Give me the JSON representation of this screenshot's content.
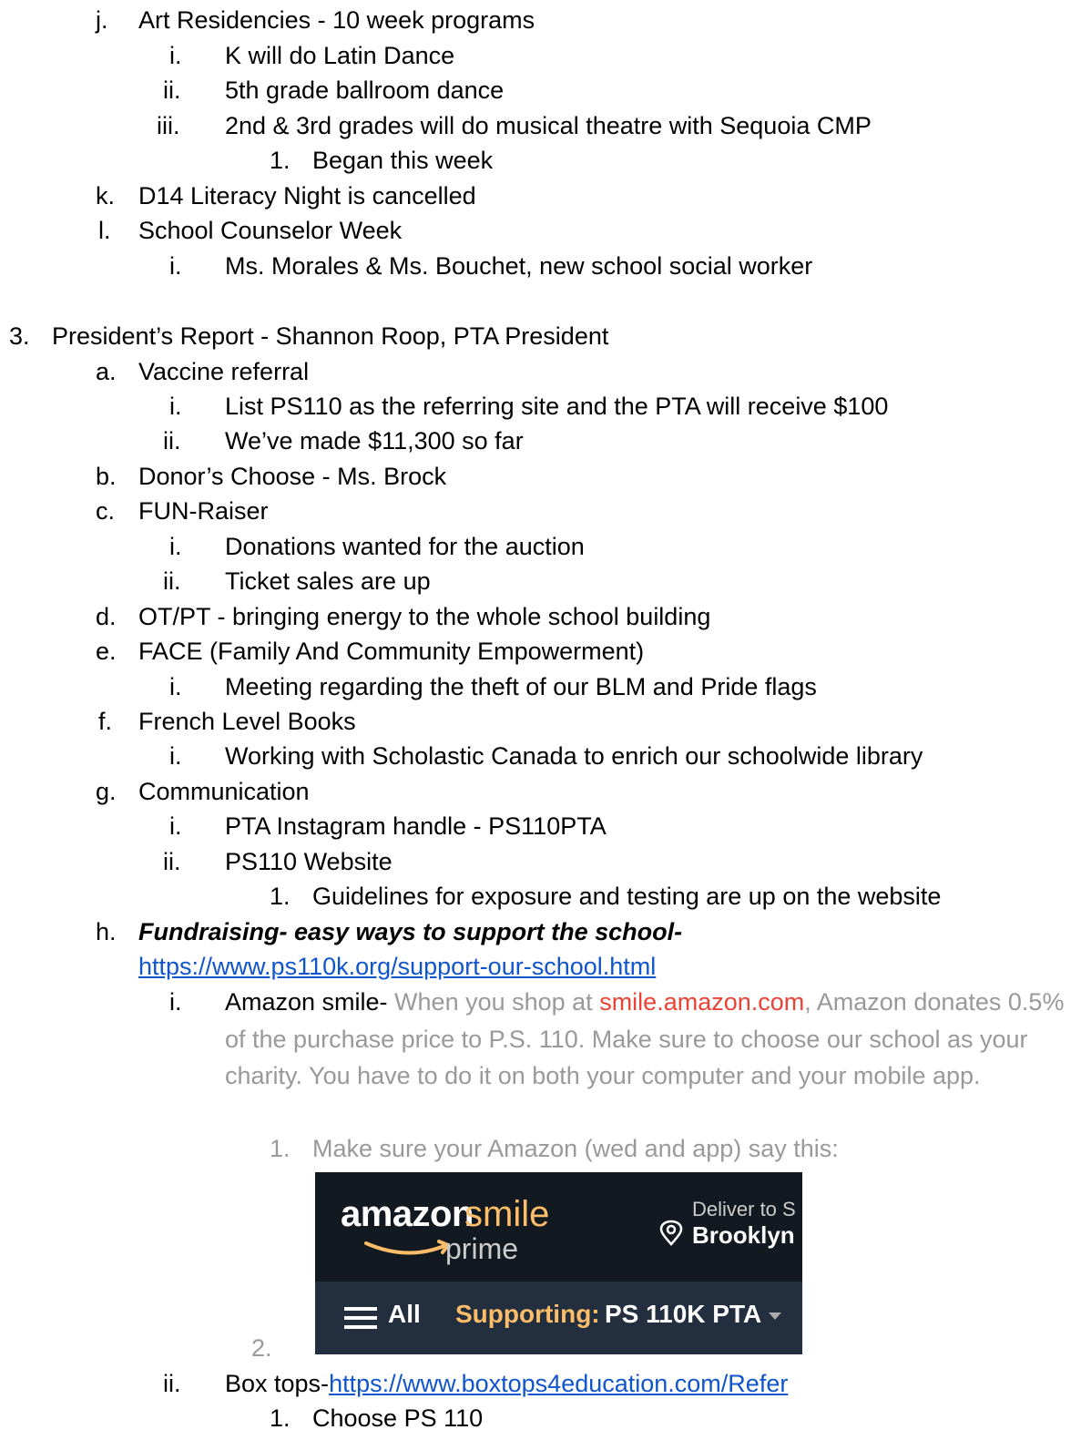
{
  "items": [
    {
      "marker": "j.",
      "text": "Art Residencies - 10 week programs"
    },
    {
      "marker": "i.",
      "text": "K will do Latin Dance"
    },
    {
      "marker": "ii.",
      "text": "5th grade ballroom dance"
    },
    {
      "marker": "iii.",
      "text": "2nd & 3rd grades will do musical theatre with Sequoia CMP"
    },
    {
      "marker": "1.",
      "text": "Began this week"
    },
    {
      "marker": "k.",
      "text": "D14 Literacy Night is cancelled"
    },
    {
      "marker": "l.",
      "text": "School Counselor Week"
    },
    {
      "marker": "i.",
      "text": "Ms. Morales & Ms. Bouchet, new school social worker"
    },
    {
      "marker": "3.",
      "text": "President’s Report - Shannon Roop, PTA President"
    },
    {
      "marker": "a.",
      "text": "Vaccine referral"
    },
    {
      "marker": "i.",
      "text": "List PS110 as the referring site and the PTA will receive $100"
    },
    {
      "marker": "ii.",
      "text": "We’ve made $11,300 so far"
    },
    {
      "marker": "b.",
      "text": "Donor’s Choose - Ms. Brock"
    },
    {
      "marker": "c.",
      "text": "FUN-Raiser"
    },
    {
      "marker": "i.",
      "text": "Donations wanted for the auction"
    },
    {
      "marker": "ii.",
      "text": "Ticket sales are up"
    },
    {
      "marker": "d.",
      "text": "OT/PT - bringing energy to the whole school building"
    },
    {
      "marker": "e.",
      "text": "FACE (Family And Community Empowerment)"
    },
    {
      "marker": "i.",
      "text": "Meeting regarding the theft of our BLM and Pride flags"
    },
    {
      "marker": "f.",
      "text": "French Level Books"
    },
    {
      "marker": "i.",
      "text": "Working with Scholastic Canada to enrich our schoolwide library"
    },
    {
      "marker": "g.",
      "text": "Communication"
    },
    {
      "marker": "i.",
      "text": "PTA Instagram handle - PS110PTA"
    },
    {
      "marker": "ii.",
      "text": "PS110 Website"
    },
    {
      "marker": "1.",
      "text": "Guidelines for exposure and testing are up on the website"
    }
  ],
  "fundraising": {
    "marker": "h.",
    "title": "Fundraising- easy ways to support the school-",
    "link": "https://www.ps110k.org/support-our-school.html"
  },
  "amazon_smile": {
    "marker": "i.",
    "label": "Amazon smile-",
    "text_before": " When you shop at ",
    "link": "smile.amazon.com",
    "text_after": ", Amazon donates 0.5% of the purchase price to P.S. 110. Make sure to choose our school as your charity. You have to do it on both your computer and your mobile app.",
    "sub1_marker": "1.",
    "sub1_text": "Make sure your Amazon (wed and app) say this:",
    "sub2_marker": "2."
  },
  "amazon_banner": {
    "logo_amazon": "amazon",
    "logo_smile": "smile",
    "logo_prime": "prime",
    "deliver_label": "Deliver to S",
    "deliver_city": "Brooklyn",
    "menu_label": "All",
    "supporting_label": "Supporting:",
    "supporting_charity": "PS 110K PTA",
    "colors": {
      "bar_top": "#131921",
      "bar_bottom": "#232f3e",
      "accent": "#febd69"
    }
  },
  "box_tops": {
    "marker": "ii.",
    "label": "Box tops-",
    "link": "https://www.boxtops4education.com/Refer",
    "sub_marker": "1.",
    "sub_text": "Choose PS 110"
  }
}
